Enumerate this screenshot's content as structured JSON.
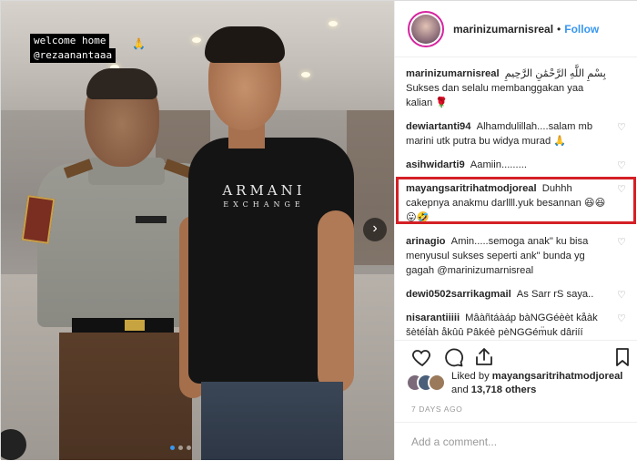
{
  "story": {
    "tag_line1": "welcome home",
    "tag_line2": "@rezaanantaaa",
    "tag_emoji": "🙏",
    "shirt_line1": "ARMANI",
    "shirt_line2": "EXCHANGE",
    "next_icon": "›"
  },
  "header": {
    "username": "marinizumarnisreal",
    "separator": "•",
    "follow_label": "Follow"
  },
  "comments": [
    {
      "user": "marinizumarnisreal",
      "text": "بِسْمِ اللَّهِ الرَّحْمَٰنِ الرَّحِيمِ Sukses dan selalu membanggakan yaa kalian 🌹",
      "heart": false
    },
    {
      "user": "dewiartanti94",
      "text": "Alhamdulillah....salam mb marini utk putra bu widya murad 🙏",
      "heart": true
    },
    {
      "user": "asihwidarti9",
      "text": "Aamiin.........",
      "heart": true
    },
    {
      "user": "mayangsaritrihatmodjoreal",
      "text": "Duhhh cakepnya anakmu darllll.yuk besannan 😆😆😛🤣",
      "heart": true
    },
    {
      "user": "arinagio",
      "text": "Amin.....semoga anak\" ku bisa menyusul sukses seperti ank\" bunda yg gagah @marinizumarnisreal",
      "heart": true
    },
    {
      "user": "dewi0502sarrikagmail",
      "text": "As Sarr rS saya..",
      "heart": true
    },
    {
      "user": "nisarantiiiii",
      "text": "Mâàñtáàáp bàNGGéèèt kåàk šètéĺàh åkûû Pâkéè pèNGGém̈uk dâriíí",
      "heart": true
    }
  ],
  "actions": {
    "like_icon": "heart-outline-icon",
    "comment_icon": "comment-bubble-icon",
    "share_icon": "share-arrow-icon",
    "save_icon": "bookmark-icon"
  },
  "likes": {
    "prefix": "Liked by",
    "user": "mayangsaritrihatmodjoreal",
    "and": "and",
    "others": "13,718 others"
  },
  "date": "7 DAYS AGO",
  "add_comment_placeholder": "Add a comment...",
  "colors": {
    "follow": "#3897f0",
    "highlight": "#d42026",
    "text": "#262626",
    "muted": "#999999"
  }
}
